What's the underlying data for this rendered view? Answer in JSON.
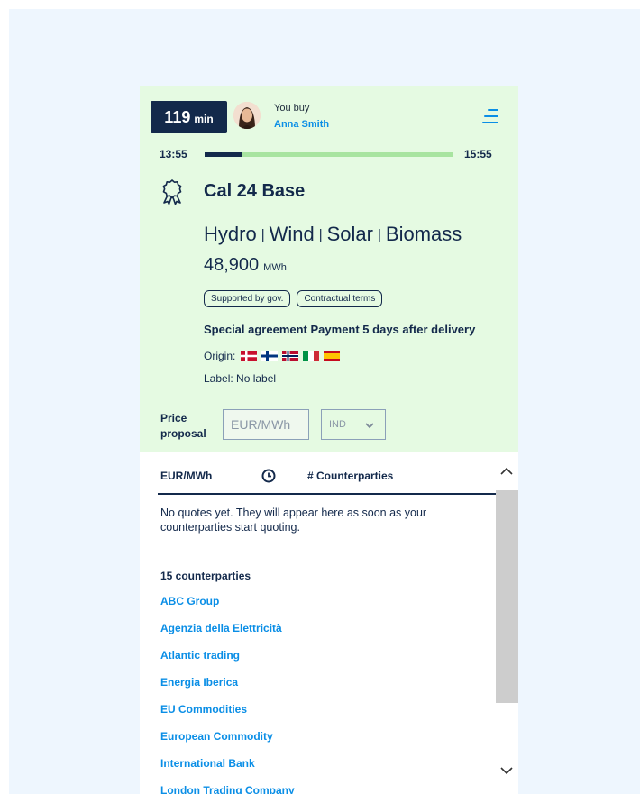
{
  "timer": {
    "value": "119",
    "unit": "min"
  },
  "buyer": {
    "label": "You buy",
    "name": "Anna Smith"
  },
  "session": {
    "start": "13:55",
    "end": "15:55",
    "elapsed_fraction": 0.15
  },
  "product": {
    "title": "Cal 24 Base",
    "sources": [
      "Hydro",
      "Wind",
      "Solar",
      "Biomass"
    ],
    "volume": "48,900",
    "volume_unit": "MWh",
    "tags": [
      "Supported by gov.",
      "Contractual terms"
    ],
    "special_terms": "Special agreement Payment 5 days after delivery",
    "origin_label": "Origin:",
    "origin_flags": [
      "Denmark",
      "Finland",
      "Norway",
      "Italy",
      "Spain"
    ],
    "label_text": "Label:  No label"
  },
  "price": {
    "label_line1": "Price",
    "label_line2": "proposal",
    "placeholder": "EUR/MWh",
    "index_value": "IND"
  },
  "quotes": {
    "col_price": "EUR/MWh",
    "col_counterparties": "# Counterparties",
    "empty_message": "No quotes yet. They will appear here as soon as your counterparties start quoting.",
    "count_label": "15 counterparties",
    "counterparties": [
      "ABC Group",
      "Agenzia della Elettricità",
      "Atlantic trading",
      "Energia Iberica",
      "EU Commodities",
      "European Commodity",
      "International Bank",
      "London Trading Company"
    ]
  },
  "colors": {
    "navy": "#13294b",
    "accent_blue": "#0a8ee6",
    "top_panel_bg": "#e5fae2",
    "progress_track": "#a8e4a0"
  },
  "icons": [
    "avatar",
    "menu-icon",
    "award-icon",
    "chevron-down-icon",
    "clock-icon",
    "chevron-up-icon"
  ]
}
